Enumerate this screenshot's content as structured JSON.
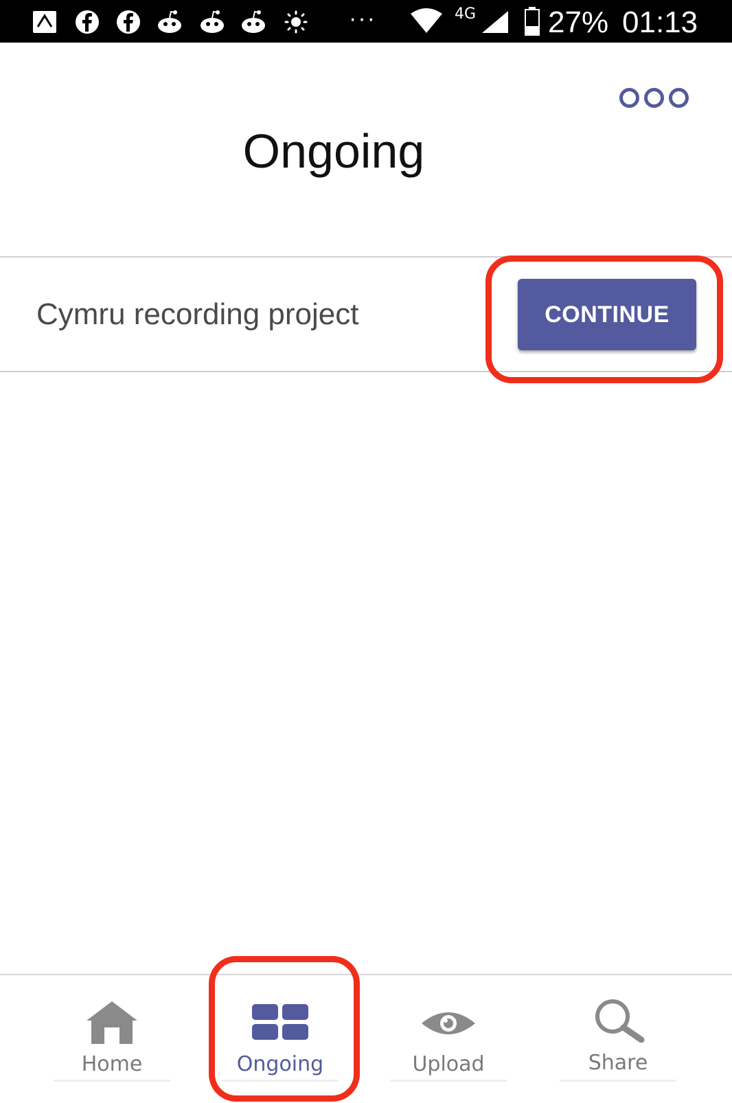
{
  "status_bar": {
    "icons": [
      "nav-app-icon",
      "facebook-icon",
      "facebook-icon",
      "reddit-icon",
      "reddit-icon",
      "reddit-icon",
      "brightness-icon"
    ],
    "more_indicator": "···",
    "wifi_icon": "wifi-icon",
    "network_type": "4G",
    "signal_icon": "signal-icon",
    "battery_icon": "battery-icon",
    "battery_level": "27%",
    "time": "01:13"
  },
  "header": {
    "title": "Ongoing",
    "menu_icon": "more-options-icon"
  },
  "projects": [
    {
      "name": "Cymru recording project",
      "action_label": "CONTINUE"
    }
  ],
  "bottom_nav": {
    "items": [
      {
        "label": "Home",
        "icon": "home-icon",
        "active": false
      },
      {
        "label": "Ongoing",
        "icon": "grid-icon",
        "active": true
      },
      {
        "label": "Upload",
        "icon": "eye-icon",
        "active": false
      },
      {
        "label": "Share",
        "icon": "search-icon",
        "active": false
      }
    ]
  },
  "colors": {
    "accent": "#535a9e",
    "highlight": "#f02e1c",
    "inactive_nav": "#7a7a7a"
  }
}
